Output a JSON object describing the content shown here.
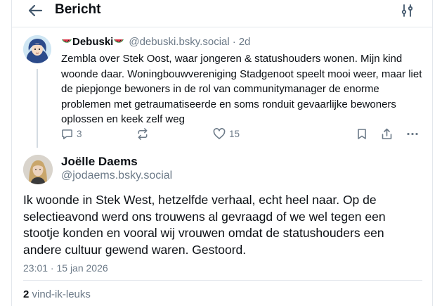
{
  "header": {
    "title": "Bericht",
    "back_icon": "arrow-left-icon",
    "settings_icon": "sliders-icon"
  },
  "parent_post": {
    "author_name": "Debuski",
    "author_emoji_icon": "watermelon-icon",
    "handle": "@debuski.bsky.social",
    "separator": "·",
    "age": "2d",
    "text": "Zembla over Stek Oost, waar jongeren & statushouders wonen. Mijn kind woonde daar. Woningbouwvereniging Stadgenoot speelt mooi weer, maar liet de piepjonge bewoners in de rol van communitymanager de enorme problemen met getraumatiseerde en soms ronduit gevaarlijke bewoners  oplossen en keek zelf weg",
    "reply_count": "3",
    "like_count": "15"
  },
  "main_post": {
    "author_name": "Joëlle Daems",
    "handle": "@jodaems.bsky.social",
    "text": "Ik woonde in Stek West, hetzelfde verhaal, echt heel naar. Op de selectieavond werd ons trouwens al gevraagd of we wel tegen een stootje konden en vooral wij vrouwen omdat de statushouders een andere cultuur gewend waren. Gestoord.",
    "timestamp": "23:01 · 15 jan 2026",
    "like_count": "2",
    "like_label": "vind-ik-leuks"
  },
  "colors": {
    "text": "#0b0f14",
    "muted": "#6c7a88",
    "divider": "#e3e7ec",
    "watermelon": "#e0364b"
  }
}
